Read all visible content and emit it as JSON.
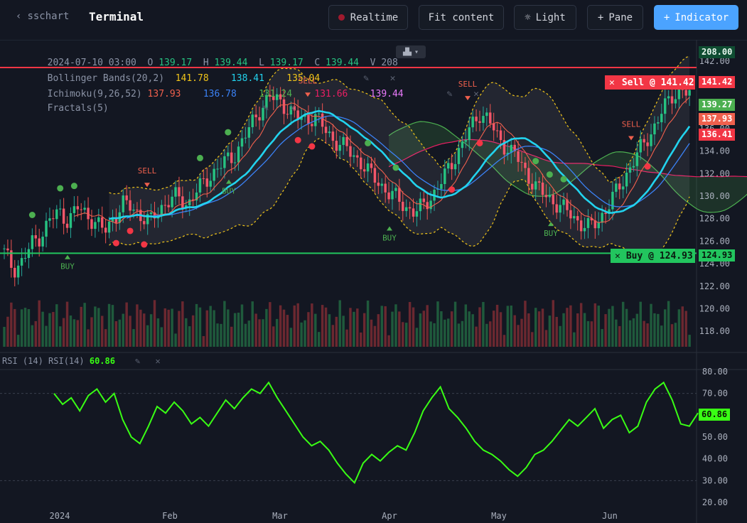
{
  "topbar": {
    "back_label": "sschart",
    "title": "Terminal",
    "buttons": {
      "realtime": "Realtime",
      "fit": "Fit content",
      "light": "Light",
      "pane": "Pane",
      "indicator": "Indicator"
    },
    "icons": {
      "light": "sun-icon",
      "pane": "plus-icon",
      "indicator": "plus-icon"
    }
  },
  "ohlcv": {
    "date": "2024-07-10 03:00",
    "o_label": "O",
    "o": "139.17",
    "h_label": "H",
    "h": "139.44",
    "l_label": "L",
    "l": "139.17",
    "c_label": "C",
    "c": "139.44",
    "v_label": "V",
    "v": "208"
  },
  "indicators": [
    {
      "name": "Bollinger Bands(20,2)",
      "values": [
        "141.78",
        "138.41",
        "135.04"
      ],
      "colors": [
        "#f0c419",
        "#22d3ee",
        "#f0c419"
      ]
    },
    {
      "name": "Ichimoku(9,26,52)",
      "values": [
        "137.93",
        "136.78",
        "131.24",
        "131.66",
        "139.44"
      ],
      "colors": [
        "#f0604d",
        "#3b82f6",
        "#4caf50",
        "#e91e63",
        "#e879f9"
      ]
    },
    {
      "name": "Fractals(5)",
      "values": []
    }
  ],
  "orders": {
    "sell": {
      "label": "Sell @ 141.42",
      "price": "141.42",
      "price_value": 141.42,
      "color": "#f23645"
    },
    "buy": {
      "label": "Buy @ 124.93",
      "price": "124.93",
      "price_value": 124.93,
      "color": "#22c55e"
    }
  },
  "price_axis": {
    "ticks": [
      "142.00",
      "140.00",
      "138.00",
      "136.00",
      "134.00",
      "132.00",
      "130.00",
      "128.00",
      "126.00",
      "124.00",
      "122.00",
      "120.00",
      "118.00"
    ],
    "tick_values": [
      142,
      140,
      138,
      136,
      134,
      132,
      130,
      128,
      126,
      124,
      122,
      120,
      118
    ],
    "volume_label": "208.00",
    "last_labels": [
      {
        "text": "139.27",
        "value": 139.27,
        "color": "#4caf50"
      },
      {
        "text": "137.93",
        "value": 137.93,
        "color": "#f0604d"
      },
      {
        "text": "136.41",
        "value": 136.41,
        "color": "#f23645"
      }
    ]
  },
  "markers": {
    "sell": "SELL",
    "buy": "BUY"
  },
  "rsi": {
    "label1": "RSI (14)",
    "label2": "RSI(14)",
    "value": "60.86",
    "ticks": [
      "80.00",
      "70.00",
      "60.00",
      "50.00",
      "40.00",
      "30.00",
      "20.00"
    ],
    "tick_values": [
      80,
      70,
      60,
      50,
      40,
      30,
      20
    ],
    "overbought": 70,
    "oversold": 30,
    "color": "#39ff14"
  },
  "time_axis": [
    "2024",
    "Feb",
    "Mar",
    "Apr",
    "May",
    "Jun"
  ],
  "chart_data": {
    "type": "candlestick",
    "y_range": [
      116.5,
      143.5
    ],
    "price_series": [
      125.0,
      123.5,
      124.2,
      125.8,
      126.5,
      127.9,
      128.6,
      127.8,
      129.0,
      128.4,
      127.6,
      126.9,
      128.1,
      129.3,
      129.0,
      128.2,
      127.7,
      128.9,
      129.6,
      130.0,
      129.2,
      130.4,
      131.3,
      132.2,
      133.0,
      133.4,
      134.8,
      136.3,
      137.7,
      138.8,
      138.5,
      137.8,
      137.0,
      136.8,
      137.1,
      136.0,
      135.0,
      134.5,
      133.8,
      133.0,
      132.0,
      131.2,
      130.3,
      129.8,
      129.0,
      128.5,
      129.3,
      130.2,
      131.5,
      133.0,
      134.4,
      136.0,
      137.4,
      136.8,
      135.2,
      134.3,
      133.6,
      132.2,
      131.0,
      130.2,
      129.6,
      129.0,
      128.4,
      127.6,
      127.2,
      127.8,
      129.0,
      130.4,
      131.8,
      133.3,
      134.7,
      135.9,
      137.5,
      138.9,
      139.4,
      139.0
    ],
    "rsi_series": [
      70,
      65,
      68,
      62,
      69,
      72,
      66,
      70,
      58,
      50,
      47,
      55,
      64,
      61,
      66,
      62,
      56,
      59,
      55,
      61,
      67,
      63,
      68,
      72,
      70,
      75,
      68,
      62,
      56,
      50,
      46,
      48,
      44,
      38,
      33,
      29,
      38,
      42,
      39,
      43,
      46,
      44,
      52,
      62,
      68,
      73,
      63,
      59,
      54,
      48,
      44,
      42,
      39,
      35,
      32,
      36,
      42,
      44,
      48,
      53,
      58,
      55,
      59,
      63,
      54,
      58,
      60,
      52,
      55,
      66,
      72,
      75,
      67,
      56,
      55,
      61
    ],
    "annotations": [
      "SELL",
      "BUY"
    ]
  }
}
